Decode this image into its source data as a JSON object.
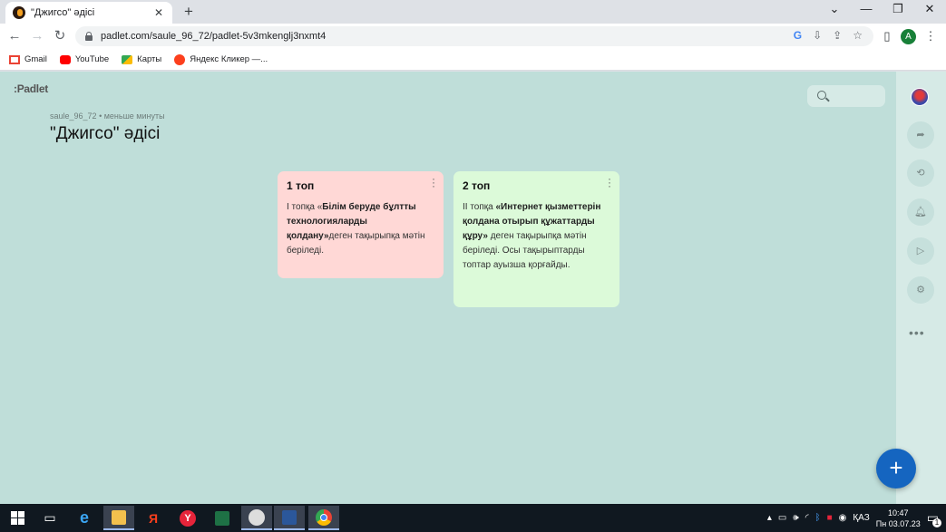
{
  "browser": {
    "tab_title": "\"Джигсо\" әдісі",
    "tab_close": "✕",
    "new_tab": "+",
    "url": "padlet.com/saule_96_72/padlet-5v3mkenglj3nxmt4",
    "window_controls": [
      "⌄",
      "—",
      "❐",
      "✕"
    ],
    "avatar_letter": "A",
    "bookmarks": [
      {
        "label": "Gmail",
        "icon": "gmail-icon"
      },
      {
        "label": "YouTube",
        "icon": "youtube-icon"
      },
      {
        "label": "Карты",
        "icon": "maps-icon"
      },
      {
        "label": "Яндекс Кликер —...",
        "icon": "yandex-icon"
      }
    ]
  },
  "padlet": {
    "logo": ":Padlet",
    "author": "saule_96_72",
    "time": "• меньше минуты",
    "title": "\"Джигсо\" әдісі",
    "cards": [
      {
        "title": "1 топ",
        "text_pre": "І топқа «",
        "text_bold": "Білім беруде бұлтты технологияларды қолдану»",
        "text_post": "деген тақырыпқа мәтін беріледі.",
        "color": "#ffd8d6"
      },
      {
        "title": "2 топ",
        "text_pre": "ІІ топқа ",
        "text_bold": "«Интернет қызметтерін қолдана отырып құжаттарды құру»",
        "text_post": " деген тақырыпқа мәтін беріледі. Осы тақырыптарды топтар ауызша қорғайды.",
        "color": "#dcfad9"
      }
    ],
    "add_button": "+",
    "more": "•••"
  },
  "taskbar": {
    "language": "ҚАЗ",
    "time": "10:47",
    "date": "Пн 03.07.23",
    "notifications": "1"
  }
}
